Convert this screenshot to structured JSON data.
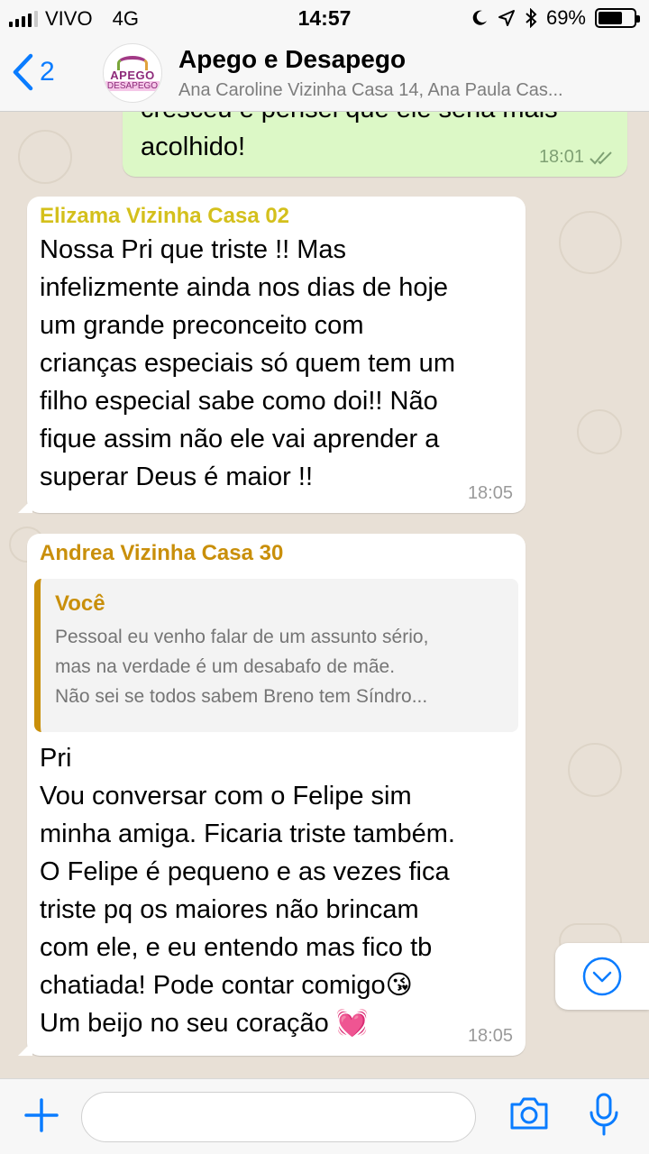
{
  "status_bar": {
    "carrier": "VIVO",
    "network": "4G",
    "time": "14:57",
    "battery": "69%",
    "battery_level": 0.69
  },
  "header": {
    "back_count": "2",
    "avatar_text_top": "APEGO",
    "avatar_text_bottom": "DESAPEGO",
    "title": "Apego e Desapego",
    "subtitle": "Ana Caroline Vizinha Casa 14, Ana Paula Cas..."
  },
  "colors": {
    "accent": "#0a7cff",
    "outgoing_bubble": "#dcf8c6",
    "incoming_bubble": "#ffffff",
    "sender_elizama": "#d4c01c",
    "sender_andrea": "#c98f0a"
  },
  "messages": [
    {
      "direction": "outgoing",
      "text": "cresceu e pensei que ele seria mais\nacolhido!",
      "time": "18:01",
      "status": "read-double-check"
    },
    {
      "direction": "incoming",
      "sender": "Elizama Vizinha Casa 02",
      "text": "Nossa Pri que triste !! Mas\ninfelizmente ainda nos dias de hoje\num grande preconceito com\ncrianças especiais só quem tem um\nfilho especial sabe como doi!! Não\nfique assim não ele vai aprender a\nsuperar Deus é maior !!",
      "time": "18:05"
    },
    {
      "direction": "incoming",
      "sender": "Andrea Vizinha Casa 30",
      "quote": {
        "author": "Você",
        "lines": [
          "Pessoal eu venho falar de um assunto sério,",
          "mas na verdade é um desabafo de mãe.",
          "Não sei se todos sabem Breno tem Síndro..."
        ]
      },
      "text": "Pri\nVou conversar com o Felipe sim\nminha amiga. Ficaria triste também.\nO Felipe é pequeno e as vezes fica\ntriste pq os maiores não brincam\ncom ele, e eu entendo mas fico tb\nchatiada! Pode contar comigo😘\nUm beijo no seu coração 💓",
      "time": "18:05"
    }
  ],
  "input": {
    "value": "",
    "placeholder": ""
  },
  "icons": {
    "back": "chevron-left-icon",
    "attach": "plus-icon",
    "camera": "camera-icon",
    "mic": "microphone-icon",
    "scroll": "chevron-down-circle-icon"
  }
}
